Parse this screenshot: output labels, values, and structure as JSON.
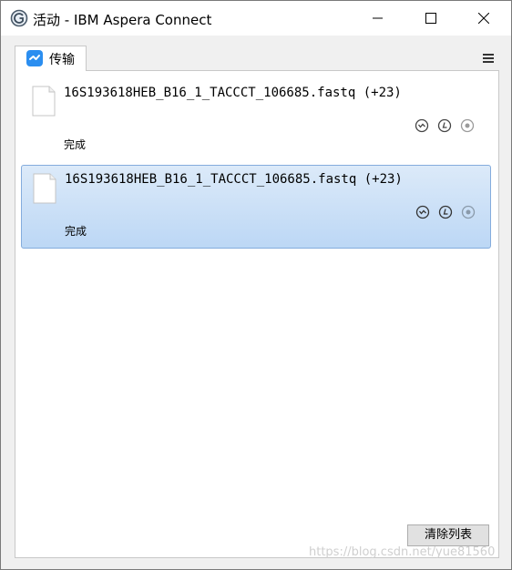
{
  "window": {
    "title": "活动 - IBM Aspera Connect",
    "app_icon": "aspera-connect-icon",
    "controls": [
      "minimize-icon",
      "maximize-icon",
      "close-icon"
    ]
  },
  "tabs": [
    {
      "label": "传输",
      "icon": "transfer-icon",
      "active": true
    }
  ],
  "transfers": [
    {
      "file_name": "16S193618HEB_B16_1_TACCCT_106685.fastq (+23)",
      "status": "完成",
      "selected": false,
      "actions": [
        "show-details-icon",
        "speed-icon",
        "stop-icon"
      ]
    },
    {
      "file_name": "16S193618HEB_B16_1_TACCCT_106685.fastq (+23)",
      "status": "完成",
      "selected": true,
      "actions": [
        "show-details-icon",
        "speed-icon",
        "stop-icon"
      ]
    }
  ],
  "footer": {
    "clear_button": "清除列表"
  },
  "watermark": "https://blog.csdn.net/yue81560",
  "colors": {
    "selection_top": "#dceaf9",
    "selection_bottom": "#bcd7f5",
    "selection_border": "#84acdd",
    "tab_icon": "#2b8ef0"
  }
}
